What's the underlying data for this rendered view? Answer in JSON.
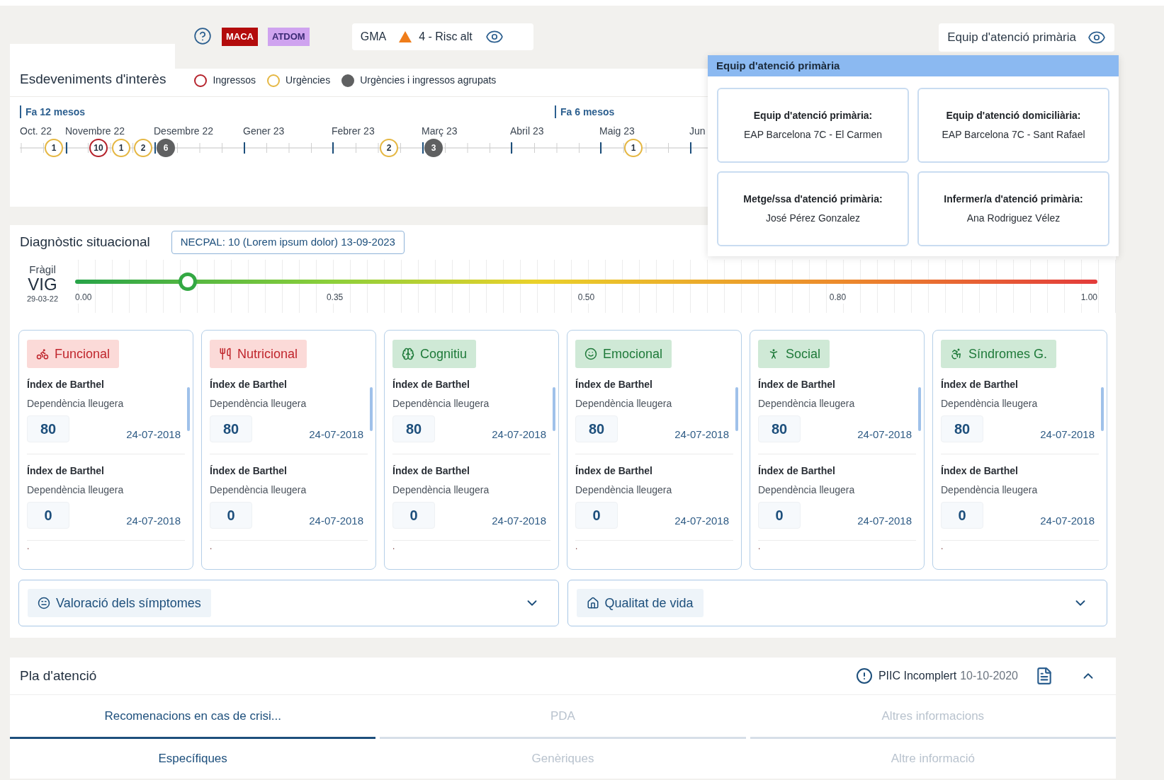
{
  "header": {
    "badges": [
      {
        "label": "MACA",
        "kind": "danger"
      },
      {
        "label": "ATDOM",
        "kind": "info"
      }
    ],
    "gma": {
      "label": "GMA",
      "risk": "4 - Risc alt"
    },
    "team_button": {
      "label": "Equip d'atenció primària"
    }
  },
  "events": {
    "title": "Esdeveniments d'interès",
    "legend": [
      {
        "kind": "ingres",
        "label": "Ingressos"
      },
      {
        "kind": "urgencia",
        "label": "Urgències"
      },
      {
        "kind": "agrupat",
        "label": "Urgències i ingressos agrupats"
      }
    ],
    "periods": [
      "Fa 12 mesos",
      "Fa 6 mesos"
    ],
    "months": [
      "Oct. 22",
      "Novembre 22",
      "Desembre 22",
      "Gener 23",
      "Febrer 23",
      "Març 23",
      "Abril 23",
      "Maig 23",
      "Jun"
    ],
    "markers": [
      {
        "kind": "urgencia",
        "count": "1"
      },
      {
        "kind": "ingres",
        "count": "10"
      },
      {
        "kind": "urgencia",
        "count": "1"
      },
      {
        "kind": "urgencia",
        "count": "2"
      },
      {
        "kind": "agrupat",
        "count": "6"
      },
      {
        "kind": "urgencia",
        "count": "2"
      },
      {
        "kind": "agrupat",
        "count": "3"
      },
      {
        "kind": "urgencia",
        "count": "1"
      }
    ]
  },
  "popup": {
    "title": "Equip d'atenció primària",
    "cards": [
      {
        "label": "Equip d'atenció primària:",
        "value": "EAP Barcelona 7C - El Carmen"
      },
      {
        "label": "Equip d'atenció domiciliària:",
        "value": "EAP Barcelona 7C - Sant Rafael"
      },
      {
        "label": "Metge/ssa d'atenció primària:",
        "value": "José Pérez Gonzalez"
      },
      {
        "label": "Infermer/a d'atenció primària:",
        "value": "Ana Rodriguez Vélez"
      }
    ]
  },
  "diagnostic": {
    "title": "Diagnòstic situacional",
    "necpal": "NECPAL: 10 (Lorem ipsum dolor) 13-09-2023",
    "vig": {
      "caption": "Fràgil",
      "name": "VIG",
      "date": "29-03-22",
      "level": 0.11,
      "ticks": [
        "0.00",
        "0.35",
        "0.50",
        "0.80",
        "1.00"
      ]
    },
    "domains": [
      {
        "name": "Funcional",
        "kind": "alert",
        "items": [
          {
            "title": "Índex de Barthel",
            "subtitle": "Dependència lleugera",
            "value": "80",
            "date": "24-07-2018"
          },
          {
            "title": "Índex de Barthel",
            "subtitle": "Dependència lleugera",
            "value": "0",
            "date": "24-07-2018"
          }
        ],
        "more": "."
      },
      {
        "name": "Nutricional",
        "kind": "alert",
        "items": [
          {
            "title": "Índex de Barthel",
            "subtitle": "Dependència lleugera",
            "value": "80",
            "date": "24-07-2018"
          },
          {
            "title": "Índex de Barthel",
            "subtitle": "Dependència lleugera",
            "value": "0",
            "date": "24-07-2018"
          }
        ],
        "more": "."
      },
      {
        "name": "Cognitiu",
        "kind": "ok",
        "items": [
          {
            "title": "Índex de Barthel",
            "subtitle": "Dependència lleugera",
            "value": "80",
            "date": "24-07-2018"
          },
          {
            "title": "Índex de Barthel",
            "subtitle": "Dependència lleugera",
            "value": "0",
            "date": "24-07-2018"
          }
        ],
        "more": "."
      },
      {
        "name": "Emocional",
        "kind": "ok",
        "items": [
          {
            "title": "Índex de Barthel",
            "subtitle": "Dependència lleugera",
            "value": "80",
            "date": "24-07-2018"
          },
          {
            "title": "Índex de Barthel",
            "subtitle": "Dependència lleugera",
            "value": "0",
            "date": "24-07-2018"
          }
        ],
        "more": "."
      },
      {
        "name": "Social",
        "kind": "ok",
        "items": [
          {
            "title": "Índex de Barthel",
            "subtitle": "Dependència lleugera",
            "value": "80",
            "date": "24-07-2018"
          },
          {
            "title": "Índex de Barthel",
            "subtitle": "Dependència lleugera",
            "value": "0",
            "date": "24-07-2018"
          }
        ],
        "more": "."
      },
      {
        "name": "Síndromes G.",
        "kind": "ok",
        "items": [
          {
            "title": "Índex de Barthel",
            "subtitle": "Dependència lleugera",
            "value": "80",
            "date": "24-07-2018"
          },
          {
            "title": "Índex de Barthel",
            "subtitle": "Dependència lleugera",
            "value": "0",
            "date": "24-07-2018"
          }
        ],
        "more": "."
      }
    ],
    "accordions": [
      {
        "label": "Valoració dels símptomes",
        "expanded": false
      },
      {
        "label": "Qualitat de vida",
        "expanded": false
      }
    ]
  },
  "plan": {
    "title": "Pla d'atenció",
    "status": "PIIC Incomplert",
    "status_date": "10-10-2020",
    "expanded": true,
    "tabs": [
      {
        "label": "Recomenacions en cas de crisi...",
        "selected": true
      },
      {
        "label": "PDA",
        "selected": false
      },
      {
        "label": "Altres informacions",
        "selected": false
      }
    ],
    "subtabs": [
      {
        "label": "Específiques",
        "selected": true
      },
      {
        "label": "Genèriques",
        "selected": false
      },
      {
        "label": "Altre informació",
        "selected": false
      }
    ]
  }
}
